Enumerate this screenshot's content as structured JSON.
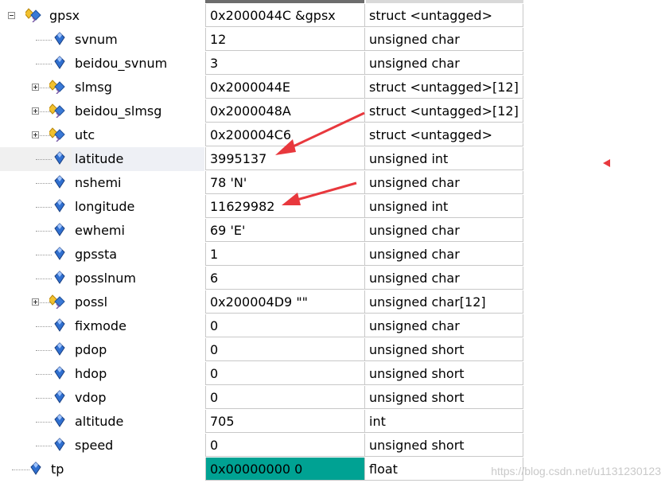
{
  "colors": {
    "selection_teal": "#00a293",
    "arrow_red": "#e8383d",
    "grid": "#c8c8c8"
  },
  "watch": {
    "root": {
      "name": "gpsx",
      "value": "0x2000044C &gpsx",
      "type": "struct <untagged>",
      "icon": "struct-icon",
      "expanded": true
    },
    "members": [
      {
        "name": "svnum",
        "value": "12",
        "type": "unsigned char",
        "icon": "variable-icon"
      },
      {
        "name": "beidou_svnum",
        "value": "3",
        "type": "unsigned char",
        "icon": "variable-icon"
      },
      {
        "name": "slmsg",
        "value": "0x2000044E",
        "type": "struct <untagged>[12]",
        "icon": "struct-icon",
        "expandable": true
      },
      {
        "name": "beidou_slmsg",
        "value": "0x2000048A",
        "type": "struct <untagged>[12]",
        "icon": "struct-icon",
        "expandable": true
      },
      {
        "name": "utc",
        "value": "0x200004C6",
        "type": "struct <untagged>",
        "icon": "struct-icon",
        "expandable": true
      },
      {
        "name": "latitude",
        "value": "3995137",
        "type": "unsigned int",
        "icon": "variable-icon",
        "selected": true
      },
      {
        "name": "nshemi",
        "value": "78 'N'",
        "type": "unsigned char",
        "icon": "variable-icon"
      },
      {
        "name": "longitude",
        "value": "11629982",
        "type": "unsigned int",
        "icon": "variable-icon"
      },
      {
        "name": "ewhemi",
        "value": "69 'E'",
        "type": "unsigned char",
        "icon": "variable-icon"
      },
      {
        "name": "gpssta",
        "value": "1",
        "type": "unsigned char",
        "icon": "variable-icon"
      },
      {
        "name": "posslnum",
        "value": "6",
        "type": "unsigned char",
        "icon": "variable-icon"
      },
      {
        "name": "possl",
        "value": "0x200004D9 \"\"",
        "type": "unsigned char[12]",
        "icon": "struct-icon",
        "expandable": true
      },
      {
        "name": "fixmode",
        "value": "0",
        "type": "unsigned char",
        "icon": "variable-icon"
      },
      {
        "name": "pdop",
        "value": "0",
        "type": "unsigned short",
        "icon": "variable-icon"
      },
      {
        "name": "hdop",
        "value": "0",
        "type": "unsigned short",
        "icon": "variable-icon"
      },
      {
        "name": "vdop",
        "value": "0",
        "type": "unsigned short",
        "icon": "variable-icon"
      },
      {
        "name": "altitude",
        "value": "705",
        "type": "int",
        "icon": "variable-icon"
      },
      {
        "name": "speed",
        "value": "0",
        "type": "unsigned short",
        "icon": "variable-icon"
      }
    ],
    "sibling": {
      "name": "tp",
      "value": "0x00000000  0",
      "type": "float",
      "icon": "variable-icon",
      "value_highlighted": true
    }
  },
  "watermark": "https://blog.csdn.net/u1131230123"
}
